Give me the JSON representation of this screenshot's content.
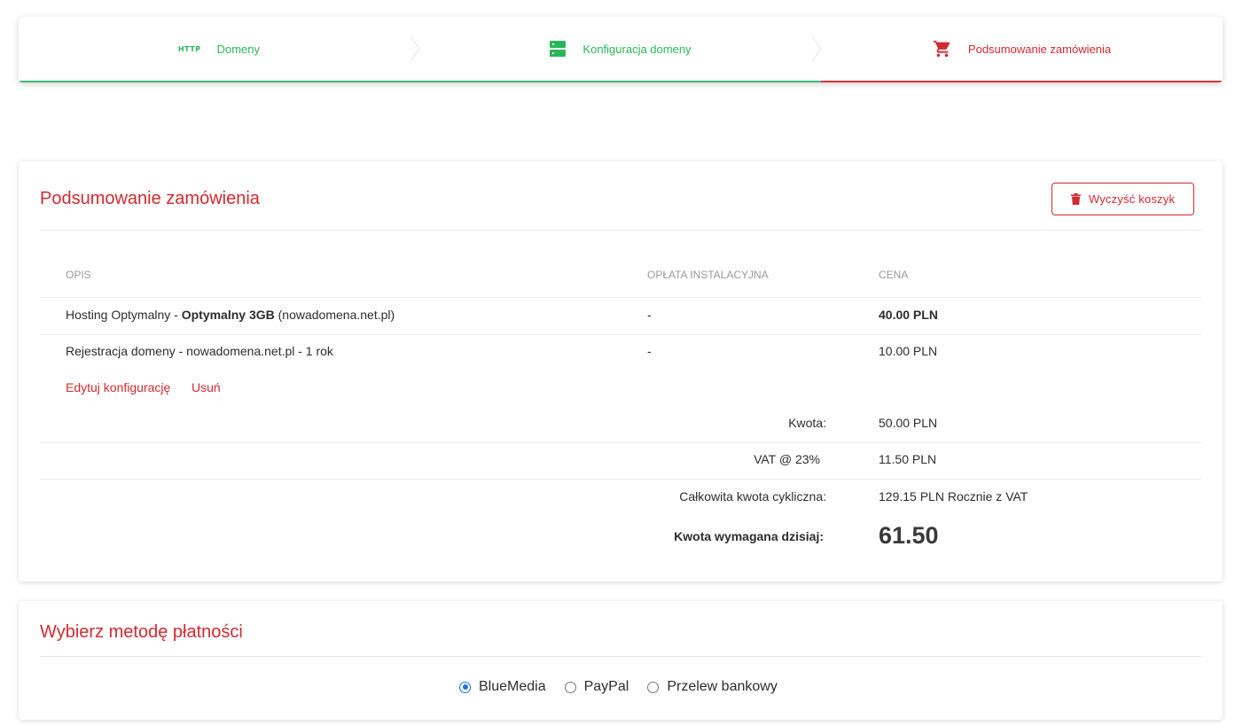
{
  "steps": [
    {
      "label": "Domeny",
      "icon": "http-icon",
      "icon_text": "HTTP",
      "color": "#2cb65a"
    },
    {
      "label": "Konfiguracja domeny",
      "icon": "server-icon",
      "color": "#2cb65a"
    },
    {
      "label": "Podsumowanie zamówienia",
      "icon": "cart-icon",
      "color": "#d12a30"
    }
  ],
  "summary": {
    "title": "Podsumowanie zamówienia",
    "clear_label": "Wyczyść koszyk",
    "columns": {
      "desc": "OPIS",
      "setup": "OPŁATA INSTALACYJNA",
      "price": "CENA"
    },
    "items": [
      {
        "desc_pre": "Hosting Optymalny - ",
        "desc_bold": "Optymalny 3GB",
        "desc_post": " (nowadomena.net.pl)",
        "setup": "-",
        "price": "40.00 PLN"
      },
      {
        "desc": "Rejestracja domeny - nowadomena.net.pl - 1 rok",
        "setup": "-",
        "price": "10.00 PLN"
      }
    ],
    "actions": {
      "edit": "Edytuj konfigurację",
      "remove": "Usuń"
    },
    "totals": {
      "amount_label": "Kwota:",
      "amount": "50.00 PLN",
      "vat_label": "VAT @ 23%",
      "vat": "11.50 PLN",
      "recurring_label": "Całkowita kwota cykliczna:",
      "recurring": "129.15 PLN Rocznie z VAT",
      "today_label": "Kwota wymagana dzisiaj:",
      "today": "61.50"
    }
  },
  "payment": {
    "title": "Wybierz metodę płatności",
    "options": [
      {
        "label": "BlueMedia",
        "checked": true
      },
      {
        "label": "PayPal",
        "checked": false
      },
      {
        "label": "Przelew bankowy",
        "checked": false
      }
    ]
  },
  "colors": {
    "accent_red": "#d12a30",
    "accent_green": "#2cb65a",
    "radio_blue": "#1a73e8"
  }
}
